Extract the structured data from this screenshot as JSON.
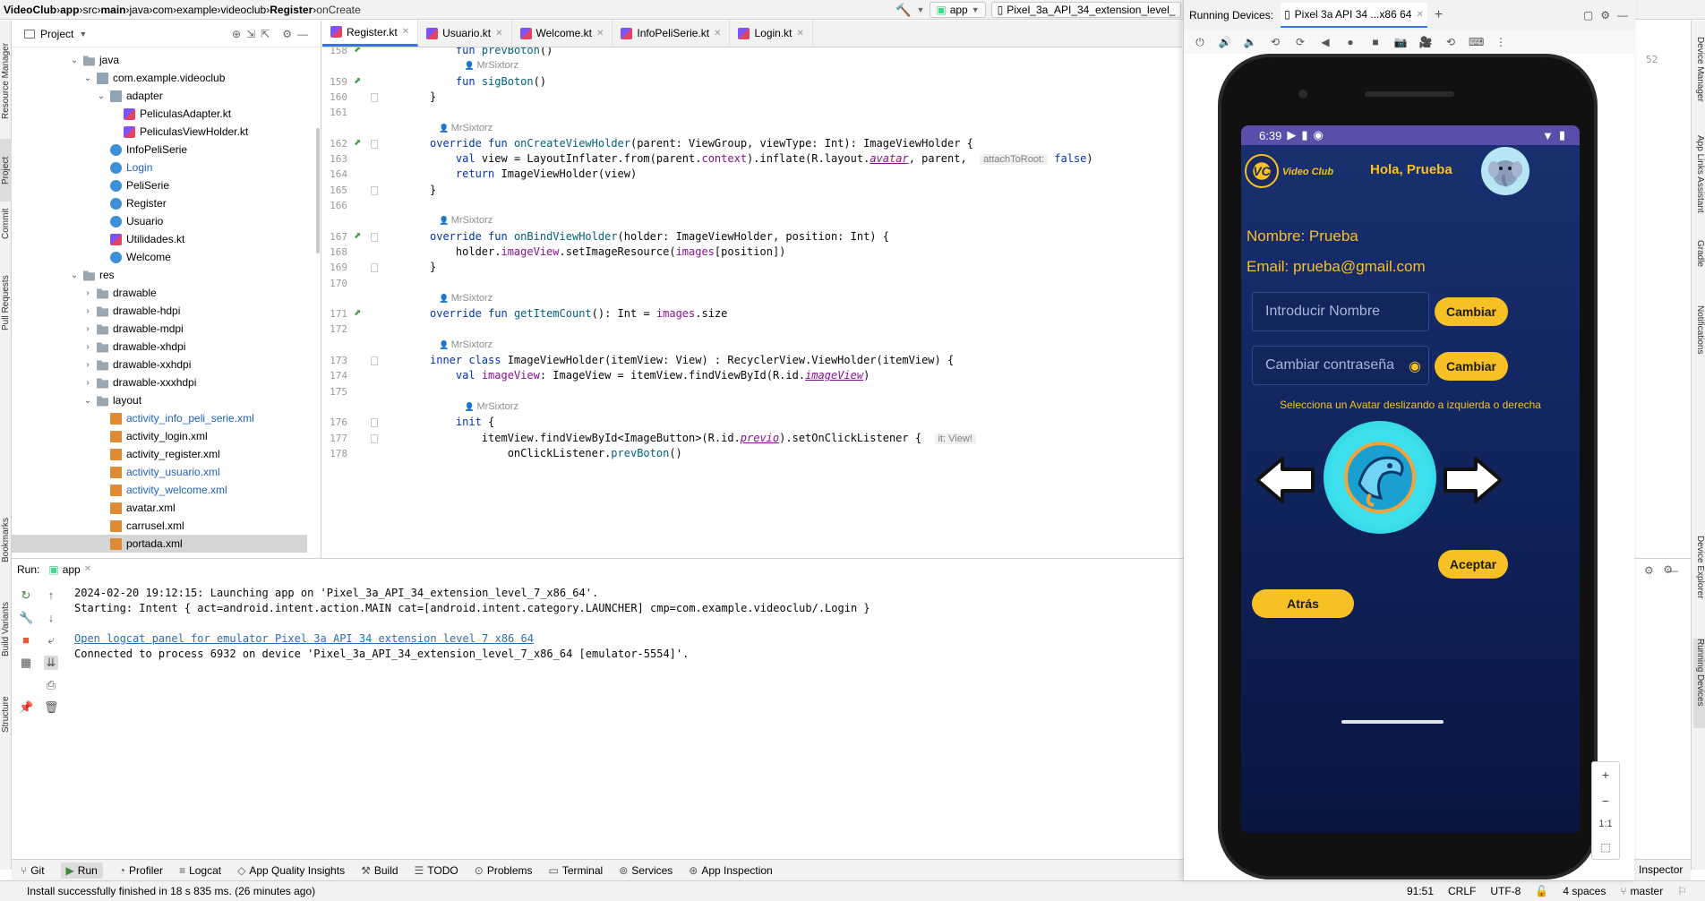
{
  "nav": {
    "crumbs": [
      "VideoClub",
      "app",
      "src",
      "main",
      "java",
      "com",
      "example",
      "videoclub",
      "Register",
      "onCreate"
    ],
    "run_config": "app",
    "device_selector": "Pixel_3a_API_34_extension_level_"
  },
  "project_panel": {
    "title": "Project",
    "tree": [
      {
        "label": "java",
        "kind": "folder",
        "indent": 0,
        "open": true
      },
      {
        "label": "com.example.videoclub",
        "kind": "pkg",
        "indent": 1,
        "open": true
      },
      {
        "label": "adapter",
        "kind": "pkg",
        "indent": 2,
        "open": true
      },
      {
        "label": "PeliculasAdapter.kt",
        "kind": "kfile",
        "indent": 3
      },
      {
        "label": "PeliculasViewHolder.kt",
        "kind": "kfile",
        "indent": 3
      },
      {
        "label": "InfoPeliSerie",
        "kind": "cfile",
        "indent": 2
      },
      {
        "label": "Login",
        "kind": "cfile",
        "indent": 2,
        "link": true
      },
      {
        "label": "PeliSerie",
        "kind": "cfile",
        "indent": 2
      },
      {
        "label": "Register",
        "kind": "cfile",
        "indent": 2
      },
      {
        "label": "Usuario",
        "kind": "cfile",
        "indent": 2
      },
      {
        "label": "Utilidades.kt",
        "kind": "kfile",
        "indent": 2
      },
      {
        "label": "Welcome",
        "kind": "cfile",
        "indent": 2
      },
      {
        "label": "res",
        "kind": "folder",
        "indent": 0,
        "open": true
      },
      {
        "label": "drawable",
        "kind": "folder",
        "indent": 1,
        "closed": true
      },
      {
        "label": "drawable-hdpi",
        "kind": "folder",
        "indent": 1,
        "closed": true
      },
      {
        "label": "drawable-mdpi",
        "kind": "folder",
        "indent": 1,
        "closed": true
      },
      {
        "label": "drawable-xhdpi",
        "kind": "folder",
        "indent": 1,
        "closed": true
      },
      {
        "label": "drawable-xxhdpi",
        "kind": "folder",
        "indent": 1,
        "closed": true
      },
      {
        "label": "drawable-xxxhdpi",
        "kind": "folder",
        "indent": 1,
        "closed": true
      },
      {
        "label": "layout",
        "kind": "folder",
        "indent": 1,
        "open": true
      },
      {
        "label": "activity_info_peli_serie.xml",
        "kind": "xfile",
        "indent": 2,
        "link": true
      },
      {
        "label": "activity_login.xml",
        "kind": "xfile",
        "indent": 2
      },
      {
        "label": "activity_register.xml",
        "kind": "xfile",
        "indent": 2
      },
      {
        "label": "activity_usuario.xml",
        "kind": "xfile",
        "indent": 2,
        "link": true
      },
      {
        "label": "activity_welcome.xml",
        "kind": "xfile",
        "indent": 2,
        "link": true
      },
      {
        "label": "avatar.xml",
        "kind": "xfile",
        "indent": 2
      },
      {
        "label": "carrusel.xml",
        "kind": "xfile",
        "indent": 2
      },
      {
        "label": "portada.xml",
        "kind": "xfile",
        "indent": 2,
        "selected": true
      }
    ]
  },
  "editor": {
    "tabs": [
      {
        "label": "Register.kt",
        "active": true
      },
      {
        "label": "Usuario.kt"
      },
      {
        "label": "Welcome.kt"
      },
      {
        "label": "InfoPeliSerie.kt"
      },
      {
        "label": "Login.kt"
      }
    ],
    "author": "MrSixtorz",
    "lines": [
      {
        "n": 158,
        "code": "    fun prevBoton()",
        "gicon": true
      },
      {
        "n": null,
        "author": true,
        "indent": 4
      },
      {
        "n": 159,
        "code": "    fun sigBoton()",
        "gicon": true
      },
      {
        "n": 160,
        "code": "}"
      },
      {
        "n": 161,
        "code": ""
      },
      {
        "n": null,
        "author": true,
        "indent": 0
      },
      {
        "n": 162,
        "code": "override fun onCreateViewHolder(parent: ViewGroup, viewType: Int): ImageViewHolder {",
        "gicon": true
      },
      {
        "n": 163,
        "code": "    val view = LayoutInflater.from(parent.context).inflate(R.layout.avatar, parent,",
        "hint": "attachToRoot:",
        "tail": " false)"
      },
      {
        "n": 164,
        "code": "    return ImageViewHolder(view)"
      },
      {
        "n": 165,
        "code": "}"
      },
      {
        "n": 166,
        "code": ""
      },
      {
        "n": null,
        "author": true,
        "indent": 0
      },
      {
        "n": 167,
        "code": "override fun onBindViewHolder(holder: ImageViewHolder, position: Int) {",
        "gicon": true
      },
      {
        "n": 168,
        "code": "    holder.imageView.setImageResource(images[position])"
      },
      {
        "n": 169,
        "code": "}"
      },
      {
        "n": 170,
        "code": ""
      },
      {
        "n": null,
        "author": true,
        "indent": 0
      },
      {
        "n": 171,
        "code": "override fun getItemCount(): Int = images.size",
        "gicon": true
      },
      {
        "n": 172,
        "code": ""
      },
      {
        "n": null,
        "author": true,
        "indent": 0
      },
      {
        "n": 173,
        "code": "inner class ImageViewHolder(itemView: View) : RecyclerView.ViewHolder(itemView) {"
      },
      {
        "n": 174,
        "code": "    val imageView: ImageView = itemView.findViewById(R.id.imageView)"
      },
      {
        "n": 175,
        "code": ""
      },
      {
        "n": null,
        "author": true,
        "indent": 4
      },
      {
        "n": 176,
        "code": "    init {"
      },
      {
        "n": 177,
        "code": "        itemView.findViewById<ImageButton>(R.id.previo).setOnClickListener {",
        "hint": "it: View!"
      },
      {
        "n": 178,
        "code": "            onClickListener.prevBoton()"
      }
    ]
  },
  "run": {
    "label": "Run:",
    "config": "app",
    "console": [
      {
        "text": "2024-02-20 19:12:15: Launching app on 'Pixel_3a_API_34_extension_level_7_x86_64'."
      },
      {
        "text": "Starting: Intent { act=android.intent.action.MAIN cat=[android.intent.category.LAUNCHER] cmp=com.example.videoclub/.Login }"
      },
      {
        "text": ""
      },
      {
        "text": "Open logcat panel for emulator Pixel 3a API 34 extension level 7 x86 64",
        "link": true
      },
      {
        "text": "Connected to process 6932 on device 'Pixel_3a_API_34_extension_level_7_x86_64 [emulator-5554]'."
      }
    ]
  },
  "toolwindows": [
    "Git",
    "Run",
    "Profiler",
    "Logcat",
    "App Quality Insights",
    "Build",
    "TODO",
    "Problems",
    "Terminal",
    "Services",
    "App Inspection"
  ],
  "left_tabs": [
    "Resource Manager",
    "Project",
    "Commit",
    "Pull Requests",
    "Bookmarks",
    "Build Variants",
    "Structure"
  ],
  "right_tabs": [
    "Device Manager",
    "App Links Assistant",
    "Gradle",
    "Notifications",
    "Device Explorer",
    "Running Devices"
  ],
  "right_bottom_label": "Inspector",
  "status": {
    "message": "Install successfully finished in 18 s 835 ms. (26 minutes ago)",
    "position": "91:51",
    "line_sep": "CRLF",
    "encoding": "UTF-8",
    "indent": "4 spaces",
    "branch": "master"
  },
  "devices": {
    "title": "Running Devices:",
    "tab": "Pixel 3a API 34 ...x86 64",
    "zoom_ratio": "1:1",
    "gutter_number": "52"
  },
  "phone": {
    "time": "6:39",
    "brand": "Video Club",
    "logo_mark": "VC",
    "greeting": "Hola, Prueba",
    "name_line": "Nombre: Prueba",
    "email_line": "Email: prueba@gmail.com",
    "name_placeholder": "Introducir Nombre",
    "password_placeholder": "Cambiar contraseña",
    "change_btn": "Cambiar",
    "avatar_hint": "Selecciona un Avatar deslizando a izquierda o derecha",
    "accept_btn": "Aceptar",
    "back_btn": "Atrás",
    "colors": {
      "accent": "#f7c024",
      "background": "#10225a",
      "status_bar": "#5a4fa8"
    }
  }
}
